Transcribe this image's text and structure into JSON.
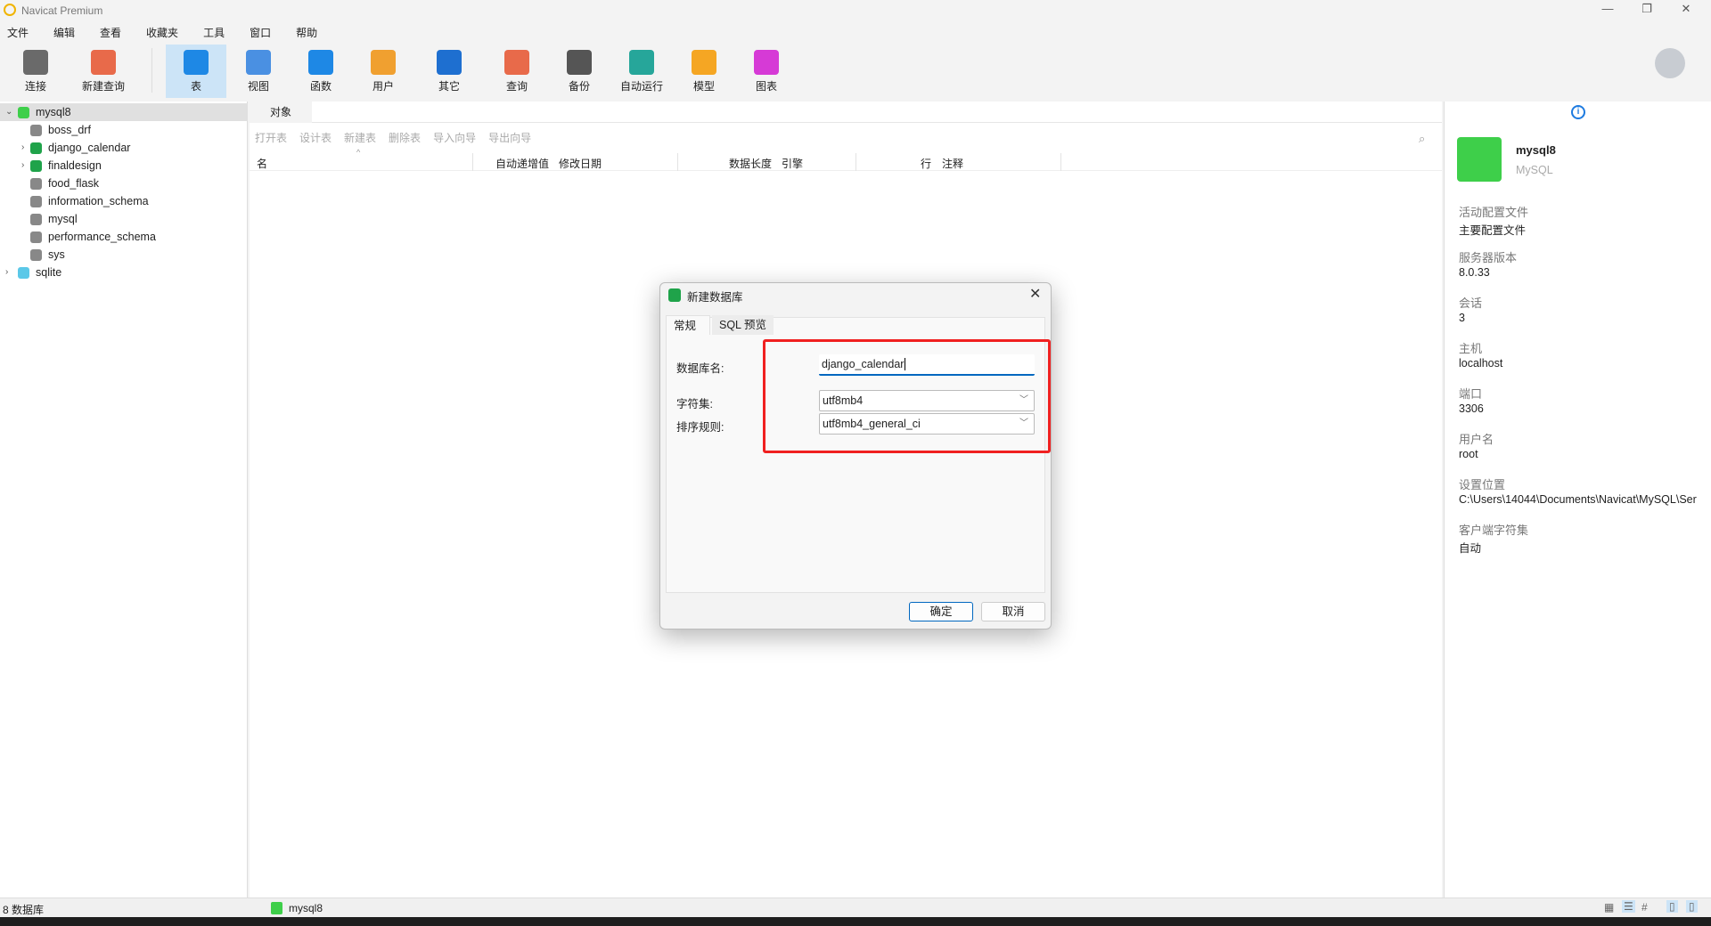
{
  "app": {
    "title": "Navicat Premium"
  },
  "menu": [
    "文件",
    "编辑",
    "查看",
    "收藏夹",
    "工具",
    "窗口",
    "帮助"
  ],
  "toolbar": [
    {
      "label": "连接",
      "icon": "plug-icon",
      "color": "#6a6a6a"
    },
    {
      "label": "新建查询",
      "icon": "new-query-icon",
      "color": "#e86a4a"
    },
    {
      "label": "表",
      "icon": "table-icon",
      "color": "#1e88e5",
      "selected": true
    },
    {
      "label": "视图",
      "icon": "view-icon",
      "color": "#4a90e2"
    },
    {
      "label": "函数",
      "icon": "function-icon",
      "color": "#1e88e5"
    },
    {
      "label": "用户",
      "icon": "user-icon",
      "color": "#f0a030"
    },
    {
      "label": "其它",
      "icon": "tools-icon",
      "color": "#1e6fd0"
    },
    {
      "label": "查询",
      "icon": "query-icon",
      "color": "#e86a4a"
    },
    {
      "label": "备份",
      "icon": "backup-icon",
      "color": "#555555"
    },
    {
      "label": "自动运行",
      "icon": "robot-icon",
      "color": "#26a69a"
    },
    {
      "label": "模型",
      "icon": "model-icon",
      "color": "#f5a623"
    },
    {
      "label": "图表",
      "icon": "chart-icon",
      "color": "#d63ad6"
    }
  ],
  "tree": [
    {
      "name": "mysql8",
      "level": 0,
      "expanded": true,
      "type": "connection",
      "color": "#3ecf4a"
    },
    {
      "name": "boss_drf",
      "level": 1,
      "type": "db-closed",
      "color": "#888888"
    },
    {
      "name": "django_calendar",
      "level": 1,
      "type": "db-open",
      "color": "#1fa34a",
      "arrow": true
    },
    {
      "name": "finaldesign",
      "level": 1,
      "type": "db-open",
      "color": "#1fa34a",
      "arrow": true
    },
    {
      "name": "food_flask",
      "level": 1,
      "type": "db-closed",
      "color": "#888888"
    },
    {
      "name": "information_schema",
      "level": 1,
      "type": "db-closed",
      "color": "#888888"
    },
    {
      "name": "mysql",
      "level": 1,
      "type": "db-closed",
      "color": "#888888"
    },
    {
      "name": "performance_schema",
      "level": 1,
      "type": "db-closed",
      "color": "#888888"
    },
    {
      "name": "sys",
      "level": 1,
      "type": "db-closed",
      "color": "#888888"
    },
    {
      "name": "sqlite",
      "level": 0,
      "expanded": false,
      "type": "connection",
      "color": "#5bc8e8"
    }
  ],
  "main": {
    "tab": "对象",
    "tools": [
      "打开表",
      "设计表",
      "新建表",
      "删除表",
      "导入向导",
      "导出向导"
    ],
    "columns": [
      "名",
      "自动递增值",
      "修改日期",
      "数据长度",
      "引擎",
      "行",
      "注释"
    ]
  },
  "info": {
    "name": "mysql8",
    "type": "MySQL",
    "fields": [
      {
        "label": "活动配置文件",
        "value": "主要配置文件"
      },
      {
        "label": "服务器版本",
        "value": "8.0.33"
      },
      {
        "label": "会话",
        "value": "3"
      },
      {
        "label": "主机",
        "value": "localhost"
      },
      {
        "label": "端口",
        "value": "3306"
      },
      {
        "label": "用户名",
        "value": "root"
      },
      {
        "label": "设置位置",
        "value": "C:\\Users\\14044\\Documents\\Navicat\\MySQL\\Ser"
      },
      {
        "label": "客户端字符集",
        "value": "自动"
      }
    ]
  },
  "dialog": {
    "title": "新建数据库",
    "tabs": [
      "常规",
      "SQL 预览"
    ],
    "db_name_label": "数据库名:",
    "db_name_value": "django_calendar",
    "charset_label": "字符集:",
    "charset_value": "utf8mb4",
    "collation_label": "排序规则:",
    "collation_value": "utf8mb4_general_ci",
    "ok": "确定",
    "cancel": "取消",
    "highlight_color": "#f02020"
  },
  "status": {
    "count": "8 数据库",
    "connection": "mysql8"
  }
}
